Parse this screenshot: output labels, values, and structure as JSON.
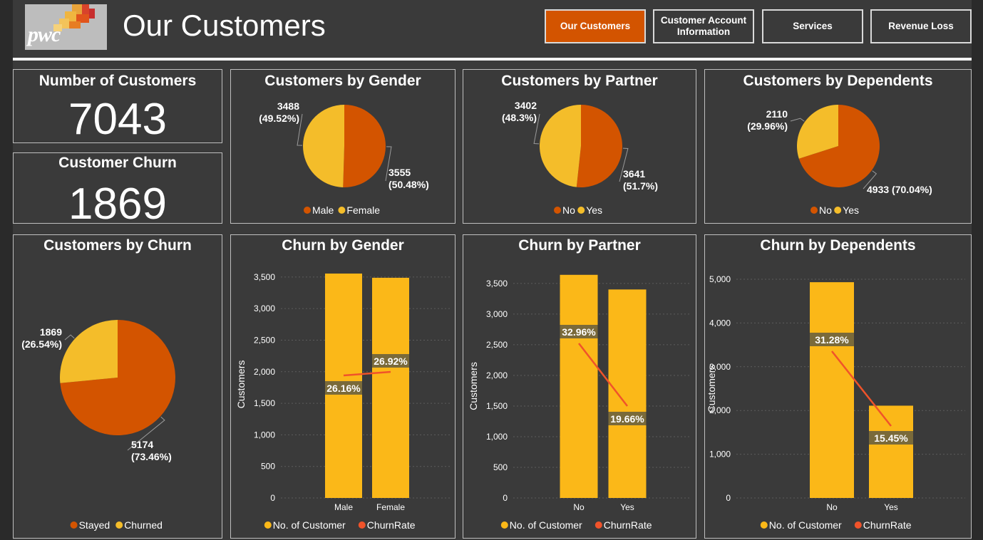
{
  "header": {
    "logo_text": "pwc",
    "title": "Our Customers",
    "nav": [
      {
        "label": "Our Customers",
        "active": true
      },
      {
        "label": "Customer Account Information",
        "active": false
      },
      {
        "label": "Services",
        "active": false
      },
      {
        "label": "Revenue Loss",
        "active": false
      }
    ]
  },
  "kpis": {
    "customers": {
      "title": "Number of Customers",
      "value": "7043"
    },
    "churn": {
      "title": "Customer Churn",
      "value": "1869"
    }
  },
  "colors": {
    "orange": "#d35400",
    "yellow": "#f4bd2a",
    "bar": "#fbb818",
    "line": "#f0532a"
  },
  "chart_data": [
    {
      "id": "gender_pie",
      "type": "pie",
      "title": "Customers by Gender",
      "labels": [
        "Male",
        "Female"
      ],
      "values": [
        3555,
        3488
      ],
      "display": [
        "3555 (50.48%)",
        "3488 (49.52%)"
      ],
      "colors": [
        "#d35400",
        "#f4bd2a"
      ],
      "legend": "bottom"
    },
    {
      "id": "partner_pie",
      "type": "pie",
      "title": "Customers by Partner",
      "labels": [
        "No",
        "Yes"
      ],
      "values": [
        3641,
        3402
      ],
      "display": [
        "3641 (51.7%)",
        "3402 (48.3%)"
      ],
      "colors": [
        "#d35400",
        "#f4bd2a"
      ],
      "legend": "bottom"
    },
    {
      "id": "dependents_pie",
      "type": "pie",
      "title": "Customers by Dependents",
      "labels": [
        "No",
        "Yes"
      ],
      "values": [
        4933,
        2110
      ],
      "display": [
        "4933 (70.04%)",
        "2110 (29.96%)"
      ],
      "colors": [
        "#d35400",
        "#f4bd2a"
      ],
      "legend": "bottom"
    },
    {
      "id": "churn_pie",
      "type": "pie",
      "title": "Customers by Churn",
      "labels": [
        "Stayed",
        "Churned"
      ],
      "values": [
        5174,
        1869
      ],
      "display": [
        "5174 (73.46%)",
        "1869 (26.54%)"
      ],
      "colors": [
        "#d35400",
        "#f4bd2a"
      ],
      "legend": "bottom"
    },
    {
      "id": "churn_gender",
      "type": "bar",
      "title": "Churn by Gender",
      "categories": [
        "Male",
        "Female"
      ],
      "ylabel": "Customers",
      "ylim": [
        0,
        3600
      ],
      "yticks": [
        0,
        500,
        1000,
        1500,
        2000,
        2500,
        3000,
        3500
      ],
      "series": [
        {
          "name": "No. of Customer",
          "values": [
            3555,
            3488
          ]
        },
        {
          "name": "ChurnRate",
          "values": [
            26.16,
            26.92
          ],
          "labels": [
            "26.16%",
            "26.92%"
          ]
        }
      ],
      "grid": true,
      "legend": "bottom"
    },
    {
      "id": "churn_partner",
      "type": "bar",
      "title": "Churn by Partner",
      "categories": [
        "No",
        "Yes"
      ],
      "ylabel": "Customers",
      "ylim": [
        0,
        3650
      ],
      "yticks": [
        0,
        500,
        1000,
        1500,
        2000,
        2500,
        3000,
        3500
      ],
      "series": [
        {
          "name": "No. of Customer",
          "values": [
            3641,
            3402
          ]
        },
        {
          "name": "ChurnRate",
          "values": [
            32.96,
            19.66
          ],
          "labels": [
            "32.96%",
            "19.66%"
          ]
        }
      ],
      "grid": true,
      "legend": "bottom"
    },
    {
      "id": "churn_dependents",
      "type": "bar",
      "title": "Churn by Dependents",
      "categories": [
        "No",
        "Yes"
      ],
      "ylabel": "Customers",
      "ylim": [
        0,
        5000
      ],
      "yticks": [
        0,
        1000,
        2000,
        3000,
        4000,
        5000
      ],
      "series": [
        {
          "name": "No. of Customer",
          "values": [
            4933,
            2110
          ]
        },
        {
          "name": "ChurnRate",
          "values": [
            31.28,
            15.45
          ],
          "labels": [
            "31.28%",
            "15.45%"
          ]
        }
      ],
      "grid": true,
      "legend": "bottom"
    }
  ]
}
